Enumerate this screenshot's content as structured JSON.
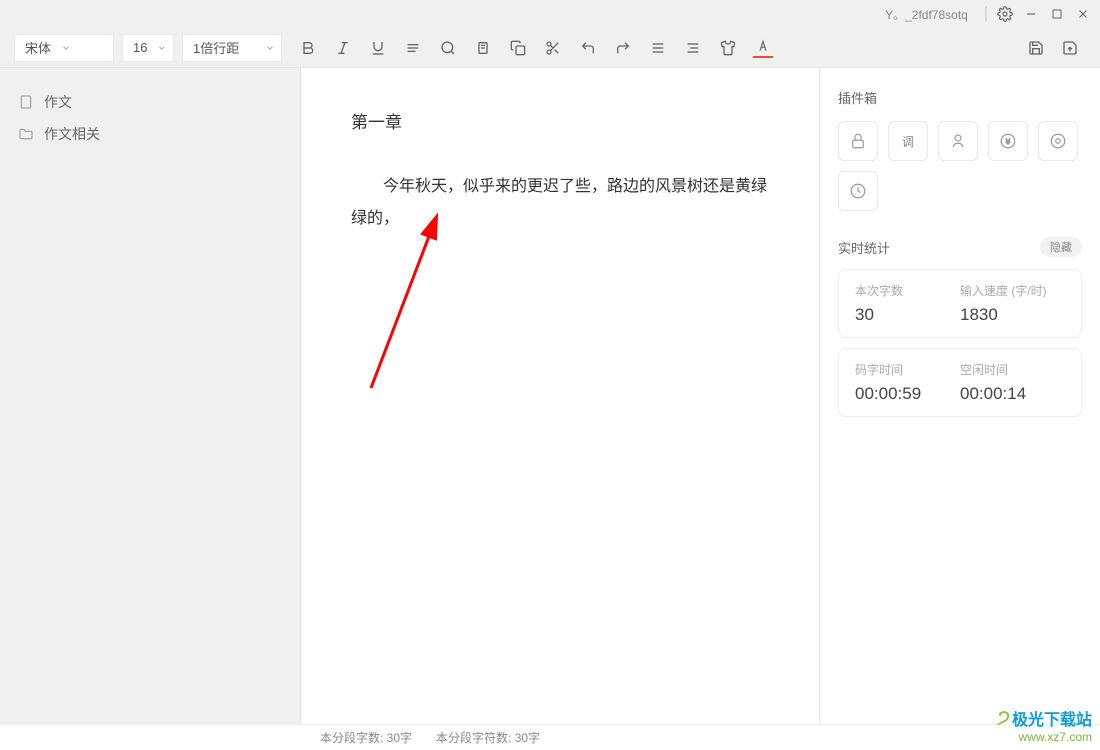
{
  "title": "Y。_2fdf78sotq",
  "toolbar": {
    "font": "宋体",
    "size": "16",
    "spacing": "1倍行距"
  },
  "sidebar": {
    "items": [
      {
        "icon": "file",
        "label": "作文"
      },
      {
        "icon": "folder",
        "label": "作文相关"
      }
    ]
  },
  "editor": {
    "chapter": "第一章",
    "body": "今年秋天，似乎来的更迟了些，路边的风景树还是黄绿绿的，"
  },
  "plugins": {
    "title": "插件箱"
  },
  "stats": {
    "title": "实时统计",
    "hide": "隐藏",
    "card1": {
      "label1": "本次字数",
      "value1": "30",
      "label2": "输入速度 (字/时)",
      "value2": "1830"
    },
    "card2": {
      "label1": "码字时间",
      "value1": "00:00:59",
      "label2": "空闲时间",
      "value2": "00:00:14"
    }
  },
  "statusbar": {
    "para_words": "本分段字数: 30字",
    "para_chars": "本分段字符数: 30字"
  },
  "watermark": {
    "brand": "极光下载站",
    "url": "www.xz7.com"
  }
}
